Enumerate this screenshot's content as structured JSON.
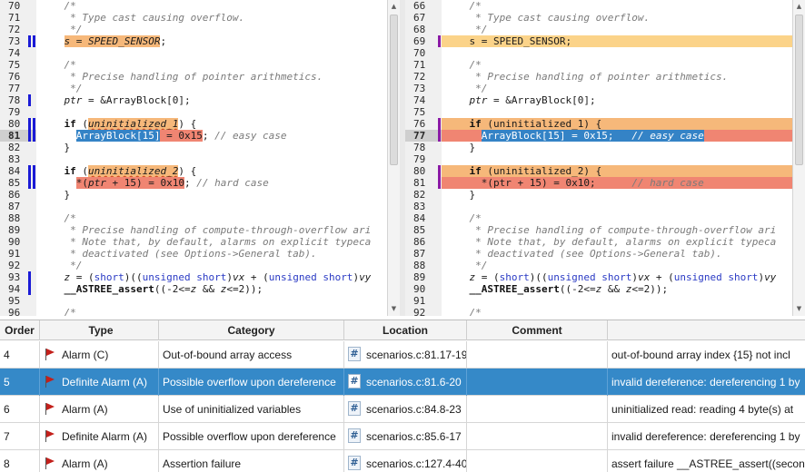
{
  "left_pane": {
    "lines": [
      {
        "n": "70",
        "parts": [
          {
            "t": "    /*",
            "c": "cm"
          }
        ]
      },
      {
        "n": "71",
        "parts": [
          {
            "t": "     * Type cast causing overflow.",
            "c": "cm"
          }
        ]
      },
      {
        "n": "72",
        "parts": [
          {
            "t": "     */",
            "c": "cm"
          }
        ]
      },
      {
        "n": "73",
        "m": [
          "b",
          "b"
        ],
        "parts": [
          {
            "t": "    "
          },
          {
            "t": "s = SPEED_SENSOR",
            "c": "it hl-orange"
          },
          {
            "t": ";"
          }
        ]
      },
      {
        "n": "74",
        "parts": []
      },
      {
        "n": "75",
        "parts": [
          {
            "t": "    /*",
            "c": "cm"
          }
        ]
      },
      {
        "n": "76",
        "parts": [
          {
            "t": "     * Precise handling of pointer arithmetics.",
            "c": "cm"
          }
        ]
      },
      {
        "n": "77",
        "parts": [
          {
            "t": "     */",
            "c": "cm"
          }
        ]
      },
      {
        "n": "78",
        "m": [
          "b",
          ""
        ],
        "parts": [
          {
            "t": "    "
          },
          {
            "t": "ptr",
            "c": "it"
          },
          {
            "t": " = &ArrayBlock[0];"
          }
        ]
      },
      {
        "n": "79",
        "parts": []
      },
      {
        "n": "80",
        "m": [
          "b",
          "b"
        ],
        "parts": [
          {
            "t": "    "
          },
          {
            "t": "if",
            "c": "kw"
          },
          {
            "t": " ("
          },
          {
            "t": "uninitialized_1",
            "c": "it hl-orange ul"
          },
          {
            "t": ") {"
          }
        ]
      },
      {
        "n": "81",
        "m": [
          "b",
          "b"
        ],
        "current": true,
        "parts": [
          {
            "t": "      "
          },
          {
            "t": "ArrayBlock[15]",
            "c": "hl-blue"
          },
          {
            "t": " = 0x15",
            "c": "hl-red"
          },
          {
            "t": "; "
          },
          {
            "t": "// easy case",
            "c": "cm"
          }
        ]
      },
      {
        "n": "82",
        "parts": [
          {
            "t": "    }"
          }
        ]
      },
      {
        "n": "83",
        "parts": []
      },
      {
        "n": "84",
        "m": [
          "b",
          "b"
        ],
        "parts": [
          {
            "t": "    "
          },
          {
            "t": "if",
            "c": "kw"
          },
          {
            "t": " ("
          },
          {
            "t": "uninitialized_2",
            "c": "it hl-orange ul"
          },
          {
            "t": ") {"
          }
        ]
      },
      {
        "n": "85",
        "m": [
          "b",
          "b"
        ],
        "parts": [
          {
            "t": "      "
          },
          {
            "t": "*(",
            "c": "hl-red"
          },
          {
            "t": "ptr",
            "c": "it hl-red"
          },
          {
            "t": " + 15) = 0x10",
            "c": "hl-red"
          },
          {
            "t": "; "
          },
          {
            "t": "// hard case",
            "c": "cm"
          }
        ]
      },
      {
        "n": "86",
        "parts": [
          {
            "t": "    }"
          }
        ]
      },
      {
        "n": "87",
        "parts": []
      },
      {
        "n": "88",
        "parts": [
          {
            "t": "    /*",
            "c": "cm"
          }
        ]
      },
      {
        "n": "89",
        "parts": [
          {
            "t": "     * Precise handling of compute-through-overflow ari",
            "c": "cm"
          }
        ]
      },
      {
        "n": "90",
        "parts": [
          {
            "t": "     * Note that, by default, alarms on explicit typeca",
            "c": "cm"
          }
        ]
      },
      {
        "n": "91",
        "parts": [
          {
            "t": "     * deactivated (see Options->General tab).",
            "c": "cm"
          }
        ]
      },
      {
        "n": "92",
        "parts": [
          {
            "t": "     */",
            "c": "cm"
          }
        ]
      },
      {
        "n": "93",
        "m": [
          "b",
          ""
        ],
        "parts": [
          {
            "t": "    "
          },
          {
            "t": "z",
            "c": "it"
          },
          {
            "t": " = ("
          },
          {
            "t": "short",
            "c": "ty"
          },
          {
            "t": ")(("
          },
          {
            "t": "unsigned short",
            "c": "ty"
          },
          {
            "t": ")"
          },
          {
            "t": "vx",
            "c": "it"
          },
          {
            "t": " + ("
          },
          {
            "t": "unsigned short",
            "c": "ty"
          },
          {
            "t": ")"
          },
          {
            "t": "vy",
            "c": "it"
          }
        ]
      },
      {
        "n": "94",
        "m": [
          "b",
          ""
        ],
        "parts": [
          {
            "t": "    "
          },
          {
            "t": "__ASTREE_assert",
            "c": "kw"
          },
          {
            "t": "((-2<="
          },
          {
            "t": "z",
            "c": "it"
          },
          {
            "t": " && "
          },
          {
            "t": "z",
            "c": "it"
          },
          {
            "t": "<=2));"
          }
        ]
      },
      {
        "n": "95",
        "parts": []
      },
      {
        "n": "96",
        "parts": [
          {
            "t": "    /*",
            "c": "cm"
          }
        ]
      }
    ]
  },
  "right_pane": {
    "lines": [
      {
        "n": "66",
        "parts": [
          {
            "t": "    /*",
            "c": "cm"
          }
        ]
      },
      {
        "n": "67",
        "parts": [
          {
            "t": "     * Type cast causing overflow.",
            "c": "cm"
          }
        ]
      },
      {
        "n": "68",
        "parts": [
          {
            "t": "     */",
            "c": "cm"
          }
        ]
      },
      {
        "n": "69",
        "m": [
          "",
          "p"
        ],
        "row": "yellow",
        "parts": [
          {
            "t": "    s = SPEED_SENSOR;"
          }
        ]
      },
      {
        "n": "70",
        "parts": []
      },
      {
        "n": "71",
        "parts": [
          {
            "t": "    /*",
            "c": "cm"
          }
        ]
      },
      {
        "n": "72",
        "parts": [
          {
            "t": "     * Precise handling of pointer arithmetics.",
            "c": "cm"
          }
        ]
      },
      {
        "n": "73",
        "parts": [
          {
            "t": "     */",
            "c": "cm"
          }
        ]
      },
      {
        "n": "74",
        "parts": [
          {
            "t": "    "
          },
          {
            "t": "ptr",
            "c": "it"
          },
          {
            "t": " = &ArrayBlock[0];"
          }
        ]
      },
      {
        "n": "75",
        "parts": []
      },
      {
        "n": "76",
        "m": [
          "",
          "p"
        ],
        "row": "orange",
        "parts": [
          {
            "t": "    "
          },
          {
            "t": "if",
            "c": "kw"
          },
          {
            "t": " (uninitialized_1) {"
          }
        ]
      },
      {
        "n": "77",
        "m": [
          "",
          "p"
        ],
        "row": "red",
        "current": true,
        "parts": [
          {
            "t": "      "
          },
          {
            "t": "ArrayBlock[15] = 0x15;   ",
            "c": "hl-blue"
          },
          {
            "t": "// easy case",
            "c": "hl-blue it"
          }
        ]
      },
      {
        "n": "78",
        "parts": [
          {
            "t": "    }"
          }
        ]
      },
      {
        "n": "79",
        "parts": []
      },
      {
        "n": "80",
        "m": [
          "",
          "p"
        ],
        "row": "orange",
        "parts": [
          {
            "t": "    "
          },
          {
            "t": "if",
            "c": "kw"
          },
          {
            "t": " (uninitialized_2) {"
          }
        ]
      },
      {
        "n": "81",
        "m": [
          "",
          "p"
        ],
        "row": "red",
        "parts": [
          {
            "t": "      *(ptr + 15) = 0x10;      "
          },
          {
            "t": "// hard case",
            "c": "cm"
          }
        ]
      },
      {
        "n": "82",
        "parts": [
          {
            "t": "    }"
          }
        ]
      },
      {
        "n": "83",
        "parts": []
      },
      {
        "n": "84",
        "parts": [
          {
            "t": "    /*",
            "c": "cm"
          }
        ]
      },
      {
        "n": "85",
        "parts": [
          {
            "t": "     * Precise handling of compute-through-overflow ari",
            "c": "cm"
          }
        ]
      },
      {
        "n": "86",
        "parts": [
          {
            "t": "     * Note that, by default, alarms on explicit typeca",
            "c": "cm"
          }
        ]
      },
      {
        "n": "87",
        "parts": [
          {
            "t": "     * deactivated (see Options->General tab).",
            "c": "cm"
          }
        ]
      },
      {
        "n": "88",
        "parts": [
          {
            "t": "     */",
            "c": "cm"
          }
        ]
      },
      {
        "n": "89",
        "parts": [
          {
            "t": "    "
          },
          {
            "t": "z",
            "c": "it"
          },
          {
            "t": " = ("
          },
          {
            "t": "short",
            "c": "ty"
          },
          {
            "t": ")(("
          },
          {
            "t": "unsigned short",
            "c": "ty"
          },
          {
            "t": ")"
          },
          {
            "t": "vx",
            "c": "it"
          },
          {
            "t": " + ("
          },
          {
            "t": "unsigned short",
            "c": "ty"
          },
          {
            "t": ")"
          },
          {
            "t": "vy",
            "c": "it"
          }
        ]
      },
      {
        "n": "90",
        "parts": [
          {
            "t": "    "
          },
          {
            "t": "__ASTREE_assert",
            "c": "kw"
          },
          {
            "t": "((-2<="
          },
          {
            "t": "z",
            "c": "it"
          },
          {
            "t": " && "
          },
          {
            "t": "z",
            "c": "it"
          },
          {
            "t": "<=2));"
          }
        ]
      },
      {
        "n": "91",
        "parts": []
      },
      {
        "n": "92",
        "parts": [
          {
            "t": "    /*",
            "c": "cm"
          }
        ]
      }
    ]
  },
  "table": {
    "headers": {
      "order": "Order",
      "type": "Type",
      "category": "Category",
      "location": "Location",
      "comment": "Comment",
      "message": ""
    },
    "rows": [
      {
        "order": "4",
        "type": "Alarm (C)",
        "category": "Out-of-bound array access",
        "location": "scenarios.c:81.17-19",
        "comment": "",
        "message": "out-of-bound array index {15} not incl",
        "selected": false
      },
      {
        "order": "5",
        "type": "Definite Alarm (A)",
        "category": "Possible overflow upon dereference",
        "location": "scenarios.c:81.6-20",
        "comment": "",
        "message": "invalid dereference: dereferencing 1 by",
        "selected": true
      },
      {
        "order": "6",
        "type": "Alarm (A)",
        "category": "Use of uninitialized variables",
        "location": "scenarios.c:84.8-23",
        "comment": "",
        "message": "uninitialized read: reading 4 byte(s) at",
        "selected": false
      },
      {
        "order": "7",
        "type": "Definite Alarm (A)",
        "category": "Possible overflow upon dereference",
        "location": "scenarios.c:85.6-17",
        "comment": "",
        "message": "invalid dereference: dereferencing 1 by",
        "selected": false
      },
      {
        "order": "8",
        "type": "Alarm (A)",
        "category": "Assertion failure",
        "location": "scenarios.c:127.4-40",
        "comment": "",
        "message": "assert failure __ASTREE_assert((second",
        "selected": false
      }
    ]
  },
  "icons": {
    "scroll_up": "▲",
    "scroll_down": "▼",
    "location": "#"
  },
  "colors": {
    "marker_blue": "#1a1ad6",
    "marker_purple": "#8b1aa6",
    "selection_blue": "#3589c8",
    "flag_red": "#c3201b"
  }
}
